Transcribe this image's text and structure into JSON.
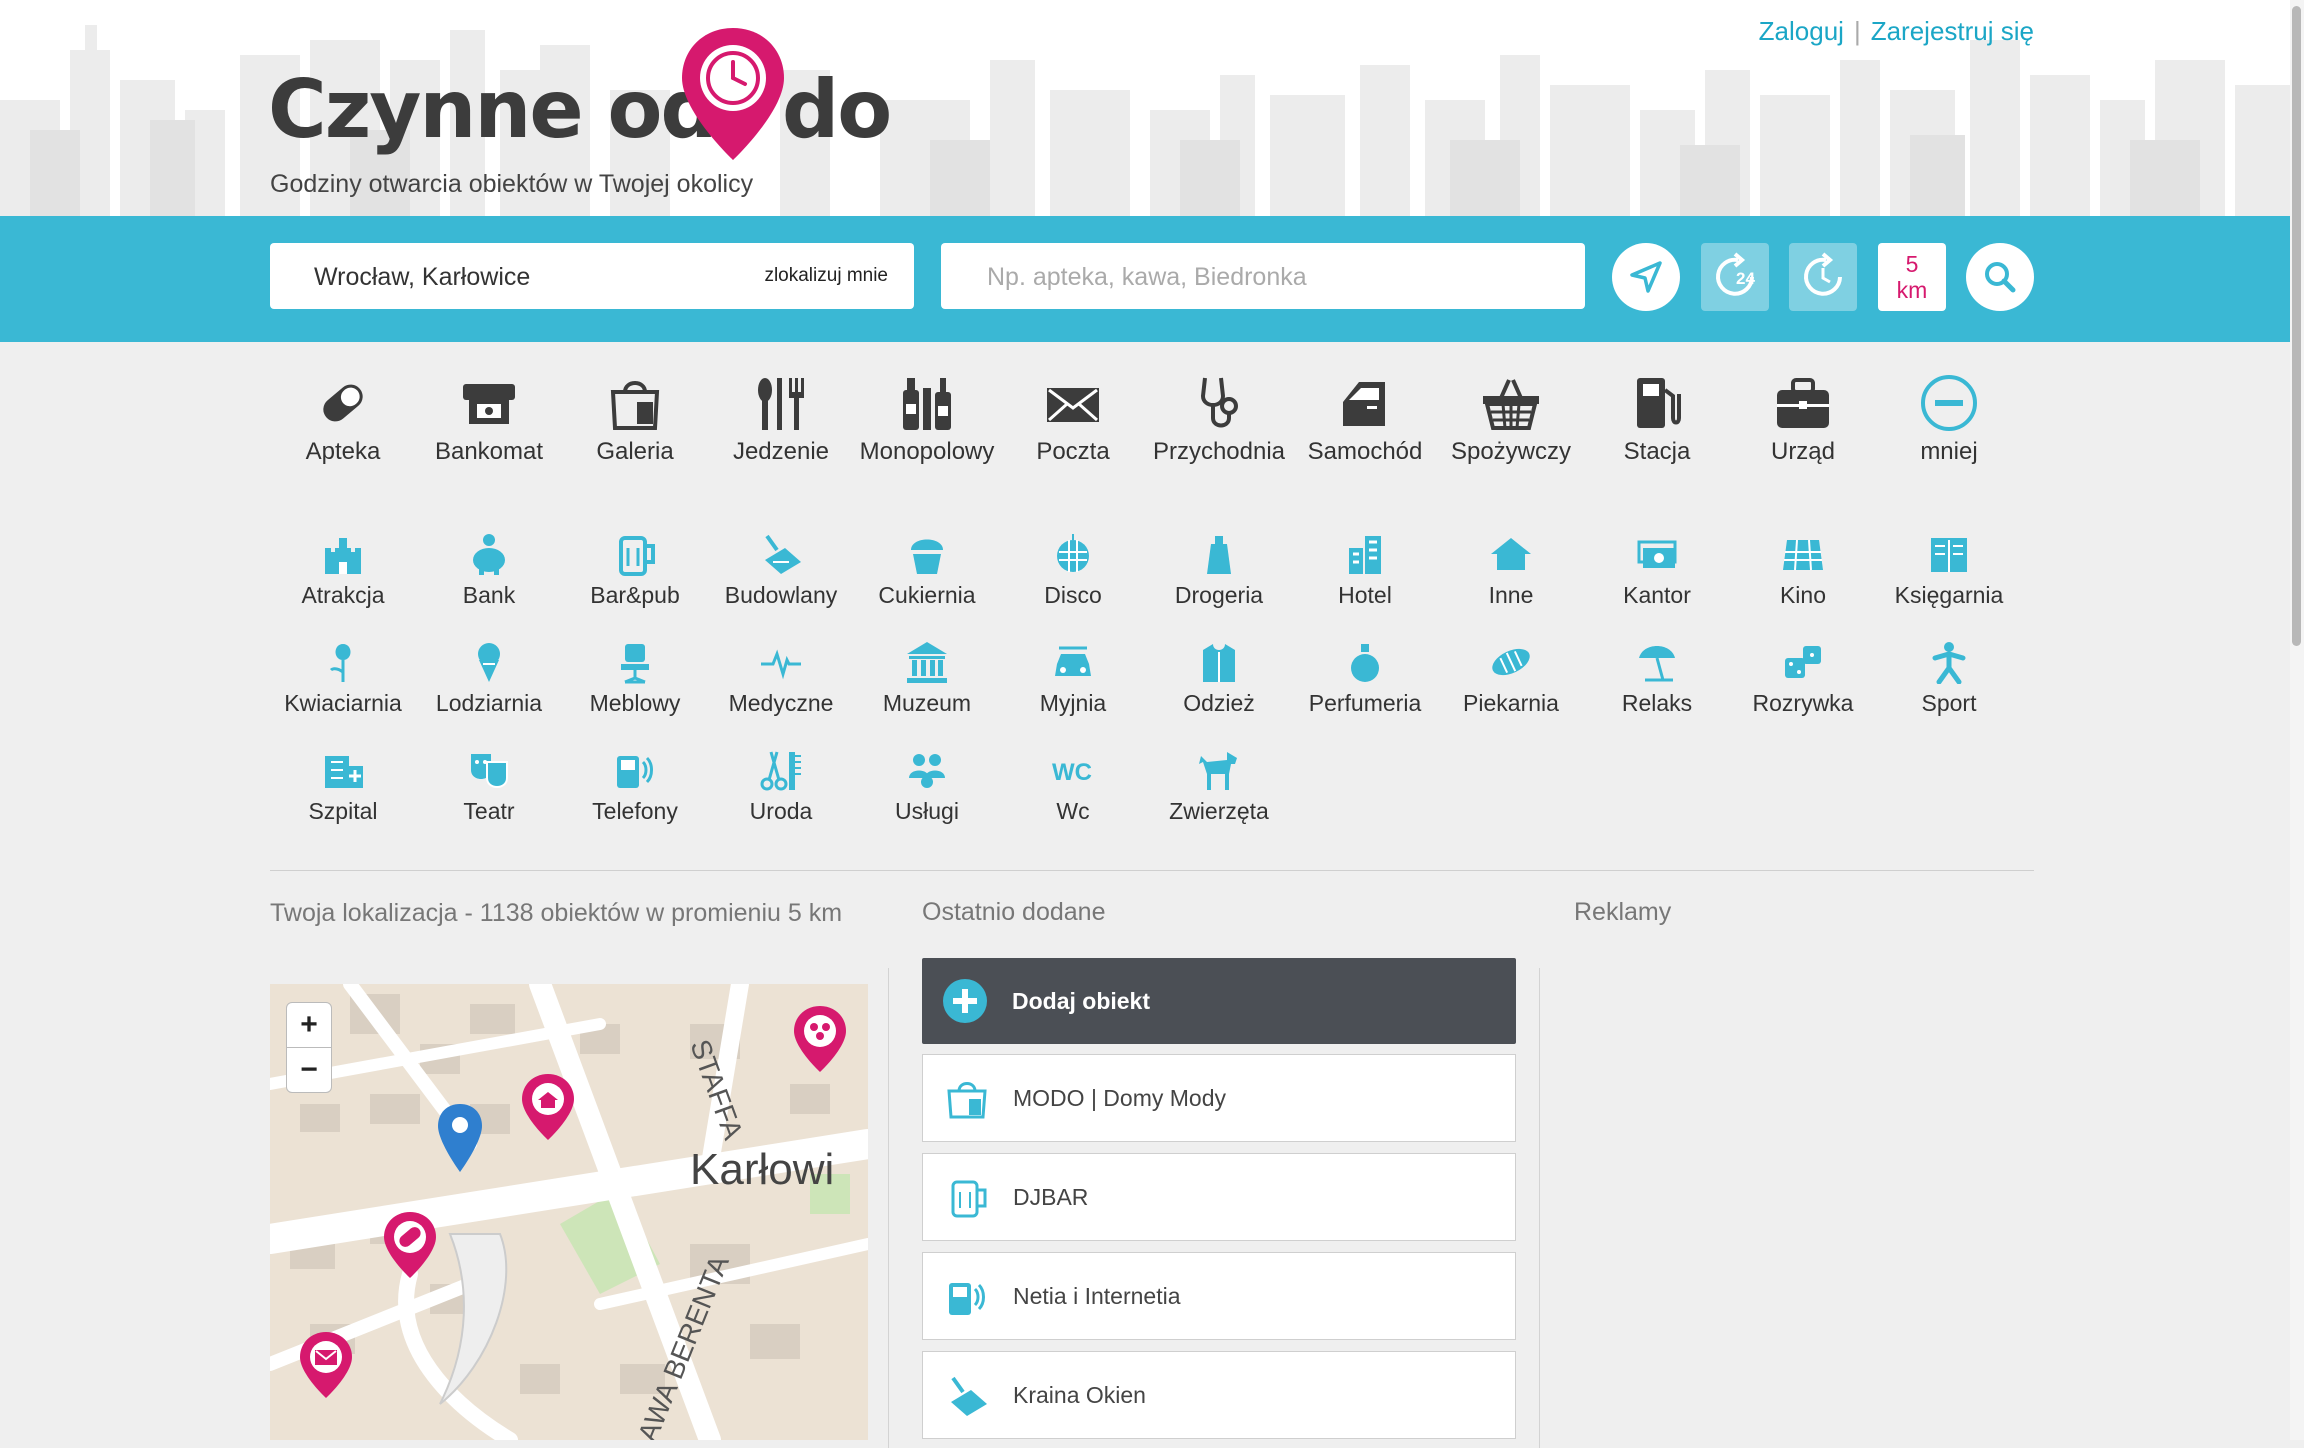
{
  "site": {
    "logo_part1": "Czynne od",
    "logo_part2": "do",
    "tagline": "Godziny otwarcia obiektów w Twojej okolicy"
  },
  "auth": {
    "login": "Zaloguj",
    "separator": "|",
    "register": "Zarejestruj się"
  },
  "search": {
    "location_value": "Wrocław, Karłowice",
    "locate_me": "zlokalizuj mnie",
    "query_placeholder": "Np. apteka, kawa, Biedronka",
    "radius_value": "5",
    "radius_unit": "km"
  },
  "colors": {
    "accent": "#3ab8d4",
    "brand_pink": "#d6196e",
    "dark_icon": "#3c3c3c",
    "link": "#1ba6c6"
  },
  "main_categories": [
    {
      "label": "Apteka",
      "icon": "pill-icon"
    },
    {
      "label": "Bankomat",
      "icon": "atm-icon"
    },
    {
      "label": "Galeria",
      "icon": "shopping-bag-icon"
    },
    {
      "label": "Jedzenie",
      "icon": "cutlery-icon"
    },
    {
      "label": "Monopolowy",
      "icon": "bottles-icon"
    },
    {
      "label": "Poczta",
      "icon": "envelope-icon"
    },
    {
      "label": "Przychodnia",
      "icon": "stethoscope-icon"
    },
    {
      "label": "Samochód",
      "icon": "car-door-icon"
    },
    {
      "label": "Spożywczy",
      "icon": "basket-icon"
    },
    {
      "label": "Stacja",
      "icon": "fuel-pump-icon"
    },
    {
      "label": "Urząd",
      "icon": "briefcase-icon"
    },
    {
      "label": "mniej",
      "icon": "minus-circle-icon"
    }
  ],
  "more_categories": [
    {
      "label": "Atrakcja",
      "icon": "castle-icon"
    },
    {
      "label": "Bank",
      "icon": "piggy-bank-icon"
    },
    {
      "label": "Bar&pub",
      "icon": "beer-mug-icon"
    },
    {
      "label": "Budowlany",
      "icon": "trowel-icon"
    },
    {
      "label": "Cukiernia",
      "icon": "cupcake-icon"
    },
    {
      "label": "Disco",
      "icon": "disco-ball-icon"
    },
    {
      "label": "Drogeria",
      "icon": "cosmetics-icon"
    },
    {
      "label": "Hotel",
      "icon": "hotel-building-icon"
    },
    {
      "label": "Inne",
      "icon": "house-icon"
    },
    {
      "label": "Kantor",
      "icon": "banknotes-icon"
    },
    {
      "label": "Kino",
      "icon": "film-icon"
    },
    {
      "label": "Księgarnia",
      "icon": "book-icon"
    },
    {
      "label": "Kwiaciarnia",
      "icon": "flower-icon"
    },
    {
      "label": "Lodziarnia",
      "icon": "ice-cream-icon"
    },
    {
      "label": "Meblowy",
      "icon": "office-chair-icon"
    },
    {
      "label": "Medyczne",
      "icon": "heartbeat-icon"
    },
    {
      "label": "Muzeum",
      "icon": "museum-icon"
    },
    {
      "label": "Myjnia",
      "icon": "car-wash-icon"
    },
    {
      "label": "Odzież",
      "icon": "jacket-icon"
    },
    {
      "label": "Perfumeria",
      "icon": "perfume-icon"
    },
    {
      "label": "Piekarnia",
      "icon": "bread-icon"
    },
    {
      "label": "Relaks",
      "icon": "beach-umbrella-icon"
    },
    {
      "label": "Rozrywka",
      "icon": "dice-icon"
    },
    {
      "label": "Sport",
      "icon": "runner-icon"
    },
    {
      "label": "Szpital",
      "icon": "hospital-icon"
    },
    {
      "label": "Teatr",
      "icon": "theatre-masks-icon"
    },
    {
      "label": "Telefony",
      "icon": "phone-icon"
    },
    {
      "label": "Uroda",
      "icon": "scissors-comb-icon"
    },
    {
      "label": "Usługi",
      "icon": "people-icon"
    },
    {
      "label": "Wc",
      "icon": "wc-icon"
    },
    {
      "label": "Zwierzęta",
      "icon": "dog-icon"
    }
  ],
  "location_section": {
    "heading": "Twoja lokalizacja - 1138 obiektów w promieniu 5 km"
  },
  "map": {
    "zoom_in": "+",
    "zoom_out": "−",
    "street_labels": [
      "STAFFA",
      "Karłowi",
      "AWA BERENTA"
    ]
  },
  "recent": {
    "heading": "Ostatnio dodane",
    "add_label": "Dodaj obiekt",
    "items": [
      {
        "name": "MODO | Domy Mody",
        "icon": "shopping-bag-icon"
      },
      {
        "name": "DJBAR",
        "icon": "beer-mug-icon"
      },
      {
        "name": "Netia i Internetia",
        "icon": "phone-icon"
      },
      {
        "name": "Kraina Okien",
        "icon": "trowel-icon"
      }
    ]
  },
  "ads": {
    "heading": "Reklamy"
  }
}
